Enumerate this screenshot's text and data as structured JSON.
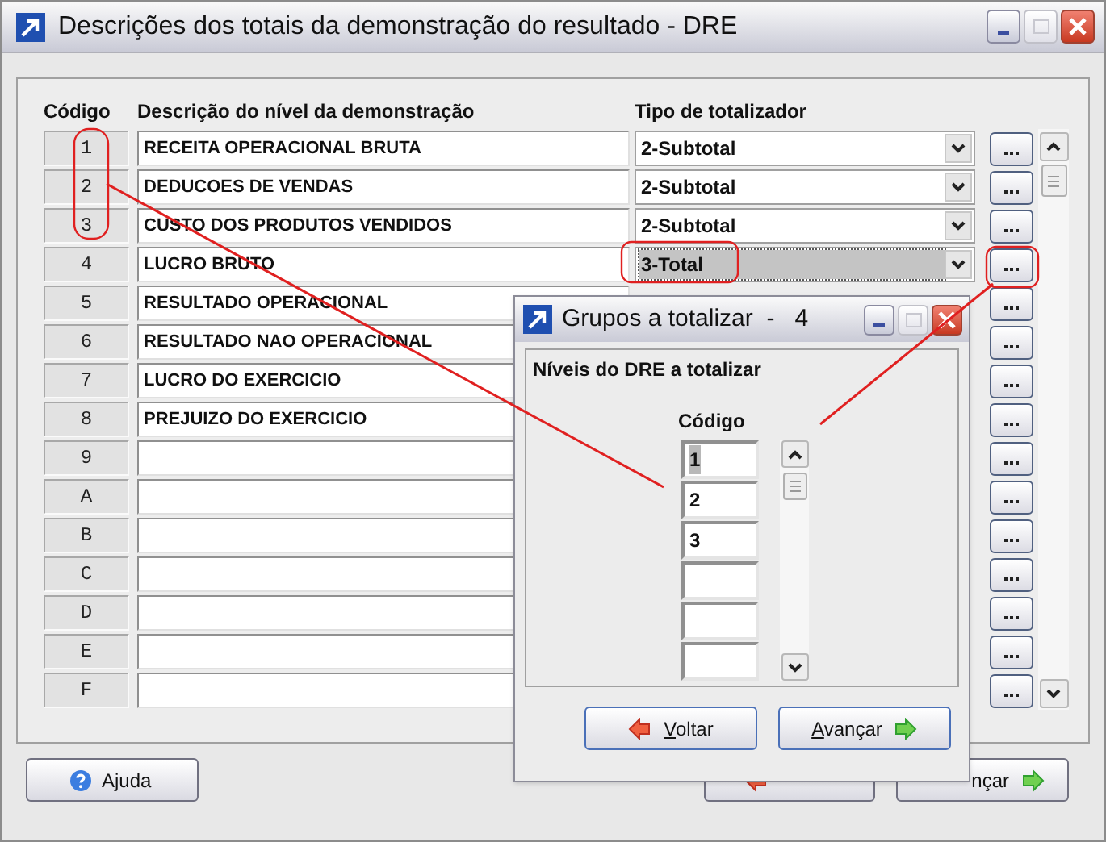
{
  "window": {
    "title": "Descrições dos totais da demonstração do resultado - DRE"
  },
  "table": {
    "columns": [
      "Código",
      "Descrição do nível da demonstração",
      "Tipo de totalizador"
    ],
    "rows": [
      {
        "code": "1",
        "description": "RECEITA OPERACIONAL BRUTA",
        "type": "2-Subtotal",
        "focused": false
      },
      {
        "code": "2",
        "description": "DEDUCOES DE VENDAS",
        "type": "2-Subtotal",
        "focused": false
      },
      {
        "code": "3",
        "description": "CUSTO DOS PRODUTOS VENDIDOS",
        "type": "2-Subtotal",
        "focused": false
      },
      {
        "code": "4",
        "description": "LUCRO BRUTO",
        "type": "3-Total",
        "focused": true
      },
      {
        "code": "5",
        "description": "RESULTADO OPERACIONAL"
      },
      {
        "code": "6",
        "description": "RESULTADO NAO OPERACIONAL"
      },
      {
        "code": "7",
        "description": "LUCRO DO EXERCICIO"
      },
      {
        "code": "8",
        "description": "PREJUIZO DO EXERCICIO"
      },
      {
        "code": "9"
      },
      {
        "code": "A"
      },
      {
        "code": "B"
      },
      {
        "code": "C"
      },
      {
        "code": "D"
      },
      {
        "code": "E"
      },
      {
        "code": "F"
      }
    ]
  },
  "footer": {
    "help": "Ajuda",
    "next_partial": "nçar"
  },
  "dialog": {
    "title": "Grupos a totalizar  -   4",
    "group": "Níveis do DRE a totalizar",
    "column": "Código",
    "codes": [
      {
        "value": "1",
        "selected": true
      },
      {
        "value": "2",
        "selected": false
      },
      {
        "value": "3",
        "selected": false
      }
    ],
    "buttons": [
      "Voltar",
      "Avançar"
    ]
  }
}
